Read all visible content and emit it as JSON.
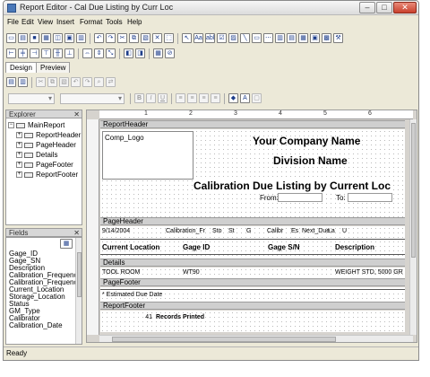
{
  "window": {
    "title": "Report Editor - Cal Due Listing by Curr Loc",
    "min": "‒",
    "max": "□",
    "close": "✕"
  },
  "menu": [
    "File",
    "Edit",
    "View",
    "Insert",
    "Format",
    "Tools",
    "Help"
  ],
  "toolbar1": {
    "text_tool": "Aa",
    "text_tool2": "abl"
  },
  "design_tabs": [
    "Design",
    "Preview"
  ],
  "format_toolbar": {
    "bold": "B",
    "italic": "I",
    "underline": "U"
  },
  "explorer": {
    "title": "Explorer",
    "root": "MainReport",
    "children": [
      "ReportHeader",
      "PageHeader",
      "Details",
      "PageFooter",
      "ReportFooter"
    ]
  },
  "fields": {
    "title": "Fields",
    "items": [
      "Gage_ID",
      "Gage_SN",
      "Description",
      "Calibration_Frequency",
      "Calibration_Frequenc...",
      "Current_Location",
      "Storage_Location",
      "Status",
      "GM_Type",
      "Calibrator",
      "Calibration_Date"
    ]
  },
  "ruler": {
    "marks": [
      "1",
      "2",
      "3",
      "4",
      "5",
      "6"
    ]
  },
  "report": {
    "bands": {
      "report_header": "ReportHeader",
      "page_header": "PageHeader",
      "details": "Details",
      "page_footer": "PageFooter",
      "report_footer": "ReportFooter"
    },
    "header": {
      "logo": "Comp_Logo",
      "company": "Your Company Name",
      "division": "Division Name",
      "title": "Calibration Due Listing by Current Loc",
      "from": "From:",
      "to": "To:"
    },
    "page_header": {
      "date": "9/14/2004",
      "fields": [
        "Calibration_Fr",
        "Sto",
        "St",
        "G",
        "Calibr",
        "Es",
        "Next_Due",
        "La",
        "U"
      ],
      "columns": [
        "Current Location",
        "Gage ID",
        "Gage S/N",
        "Description"
      ]
    },
    "details": {
      "location": "TOOL ROOM",
      "gage_id": "WT90",
      "description": "WEIGHT STD, 5000 GR"
    },
    "page_footer": {
      "note": "* Estimated Due Date"
    },
    "report_footer": {
      "count": "41",
      "label": "Records Printed"
    }
  },
  "status": "Ready"
}
